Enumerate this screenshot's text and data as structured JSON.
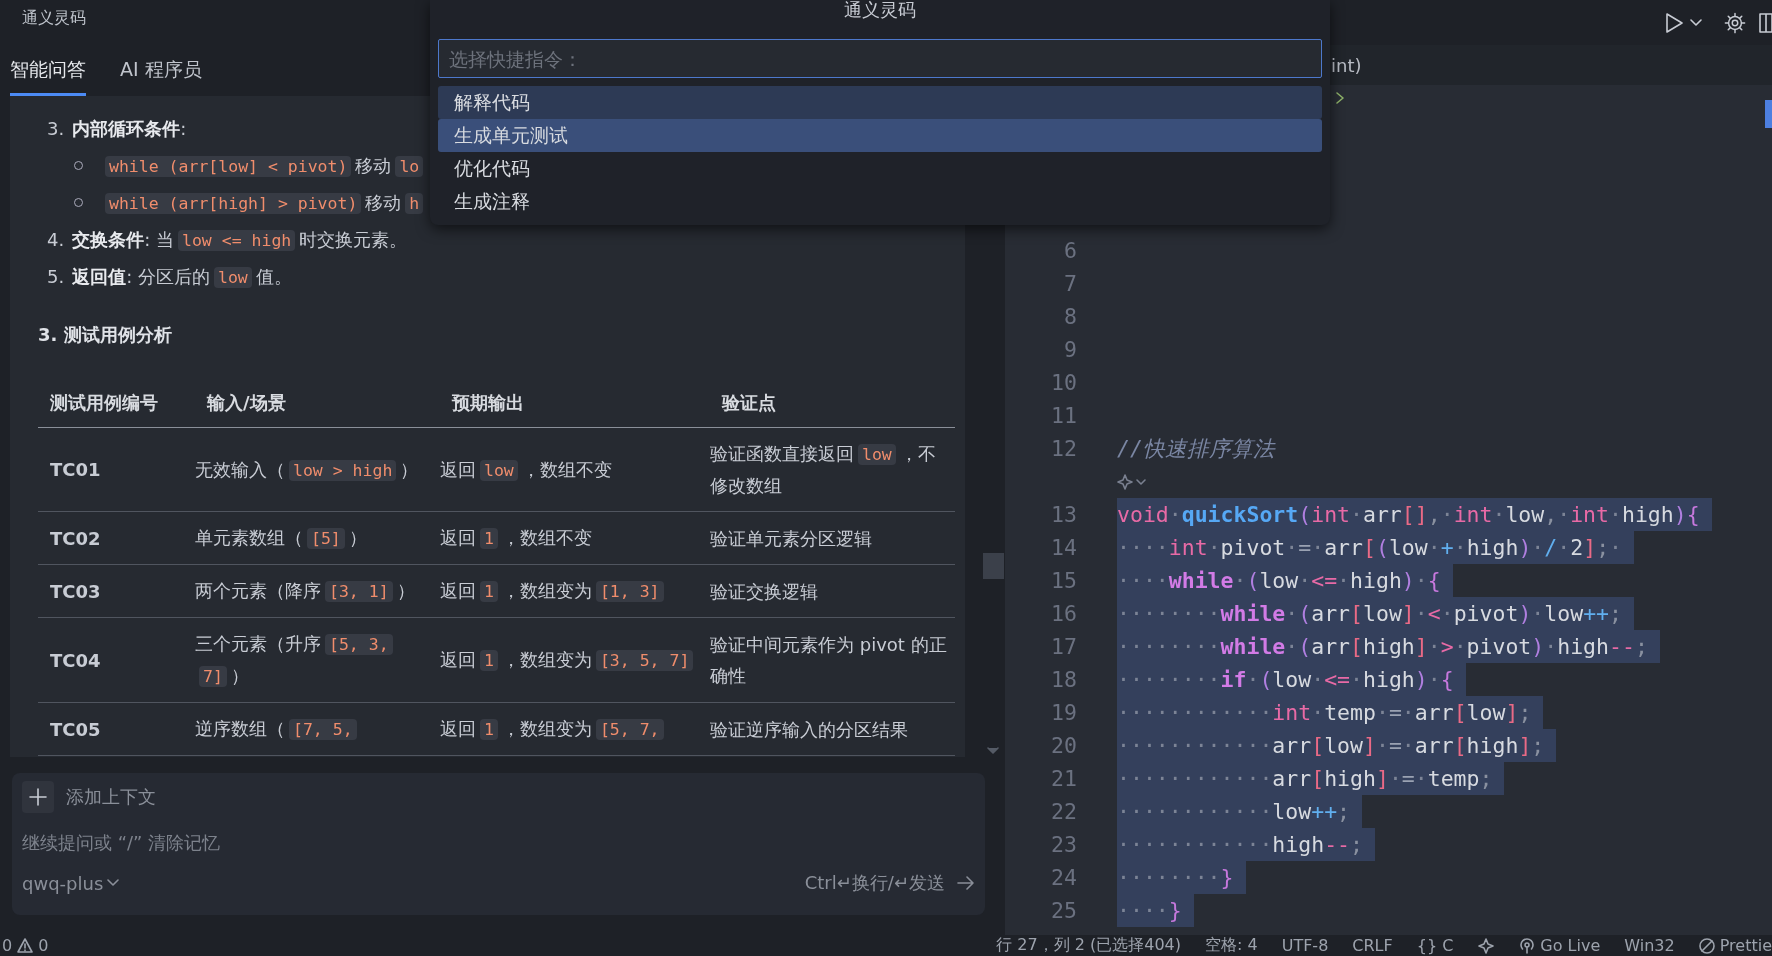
{
  "chat_panel": {
    "title": "通义灵码",
    "tabs": [
      {
        "label": "智能问答",
        "selected": true
      },
      {
        "label": "AI 程序员",
        "selected": false
      }
    ],
    "items": [
      {
        "kind": "numbered",
        "number": "3.",
        "parts": [
          {
            "text": "**内部循环条件**:"
          }
        ]
      },
      {
        "kind": "bullet",
        "parts": [
          {
            "code": "while (arr[low] < pivot)"
          },
          {
            "text": "移动"
          },
          {
            "code": "lo"
          }
        ]
      },
      {
        "kind": "bullet",
        "parts": [
          {
            "code": "while (arr[high] > pivot)"
          },
          {
            "text": "移动"
          },
          {
            "code": "h"
          }
        ]
      },
      {
        "kind": "numbered",
        "number": "4.",
        "parts": [
          {
            "text": "**交换条件**: 当"
          },
          {
            "code": "low <= high"
          },
          {
            "text": "时交换元素。"
          }
        ]
      },
      {
        "kind": "numbered",
        "number": "5.",
        "parts": [
          {
            "text": "**返回值**: 分区后的"
          },
          {
            "code": "low"
          },
          {
            "text": "值。"
          }
        ]
      }
    ],
    "heading": "3. 测试用例分析",
    "table": {
      "columns": [
        "测试用例编号",
        "输入/场景",
        "预期输出",
        "验证点"
      ],
      "rows": [
        [
          [
            {
              "text": "TC01"
            }
          ],
          [
            {
              "text": "无效输入（"
            },
            {
              "code": "low > high"
            },
            {
              "text": "）"
            }
          ],
          [
            {
              "text": "返回"
            },
            {
              "code": "low"
            },
            {
              "text": "，数组不变"
            }
          ],
          [
            {
              "text": "验证函数直接返回"
            },
            {
              "code": "low"
            },
            {
              "text": "，不修改数组"
            }
          ]
        ],
        [
          [
            {
              "text": "TC02"
            }
          ],
          [
            {
              "text": "单元素数组（"
            },
            {
              "code": "[5]"
            },
            {
              "text": "）"
            }
          ],
          [
            {
              "text": "返回"
            },
            {
              "code": "1"
            },
            {
              "text": "，数组不变"
            }
          ],
          [
            {
              "text": "验证单元素分区逻辑"
            }
          ]
        ],
        [
          [
            {
              "text": "TC03"
            }
          ],
          [
            {
              "text": "两个元素（降序"
            },
            {
              "code": "[3, 1]"
            },
            {
              "text": "）"
            }
          ],
          [
            {
              "text": "返回"
            },
            {
              "code": "1"
            },
            {
              "text": "，数组变为"
            },
            {
              "code": "[1, 3]"
            }
          ],
          [
            {
              "text": "验证交换逻辑"
            }
          ]
        ],
        [
          [
            {
              "text": "TC04"
            }
          ],
          [
            {
              "text": "三个元素（升序"
            },
            {
              "code": "[5, 3, 7]"
            },
            {
              "text": "）"
            }
          ],
          [
            {
              "text": "返回"
            },
            {
              "code": "1"
            },
            {
              "text": "，数组变为"
            },
            {
              "code": "[3, 5, 7]"
            }
          ],
          [
            {
              "text": "验证中间元素作为 pivot 的正确性"
            }
          ]
        ],
        [
          [
            {
              "text": "TC05"
            }
          ],
          [
            {
              "text": "逆序数组（"
            },
            {
              "code": "[7, 5,"
            }
          ],
          [
            {
              "text": "返回"
            },
            {
              "code": "1"
            },
            {
              "text": "，数组变为"
            },
            {
              "code": "[5, 7,"
            }
          ],
          [
            {
              "text": "验证逆序输入的分区结果"
            }
          ]
        ]
      ]
    },
    "input": {
      "add_context": "添加上下文",
      "placeholder": "继续提问或 “/” 清除记忆",
      "model": "qwq-plus",
      "hint": "Ctrl↵换行/↵发送"
    }
  },
  "command_palette": {
    "title": "通义灵码",
    "placeholder": "选择快捷指令：",
    "items": [
      {
        "label": "解释代码",
        "selected": false,
        "hovered": true
      },
      {
        "label": "生成单元测试",
        "selected": true,
        "hovered": false
      },
      {
        "label": "优化代码",
        "selected": false,
        "hovered": false
      },
      {
        "label": "生成注释",
        "selected": false,
        "hovered": false
      }
    ]
  },
  "editor": {
    "tab": "int)",
    "lines": [
      {
        "kind": "code",
        "number": "6"
      },
      {
        "kind": "code",
        "number": "7"
      },
      {
        "kind": "code",
        "number": "8"
      },
      {
        "kind": "code",
        "number": "9"
      },
      {
        "kind": "code",
        "number": "10"
      },
      {
        "kind": "code",
        "number": "11"
      },
      {
        "kind": "code",
        "number": "12",
        "selected": false,
        "tokens": [
          {
            "text": "//快速排序算法",
            "kind": "cm"
          }
        ]
      },
      {
        "kind": "lens"
      },
      {
        "kind": "code",
        "number": "13",
        "selected": true,
        "tokens": [
          {
            "text": "void",
            "kind": "kw"
          },
          {
            "text": "·",
            "kind": "ws"
          },
          {
            "text": "quickSort",
            "kind": "fn"
          },
          {
            "text": "(",
            "kind": "pa"
          },
          {
            "text": "int",
            "kind": "kw"
          },
          {
            "text": "·",
            "kind": "ws"
          },
          {
            "text": "arr",
            "kind": "id"
          },
          {
            "text": "[]",
            "kind": "br"
          },
          {
            "text": ",",
            "kind": "p"
          },
          {
            "text": "·",
            "kind": "ws"
          },
          {
            "text": "int",
            "kind": "kw"
          },
          {
            "text": "·",
            "kind": "ws"
          },
          {
            "text": "low",
            "kind": "id"
          },
          {
            "text": ",",
            "kind": "p"
          },
          {
            "text": "·",
            "kind": "ws"
          },
          {
            "text": "int",
            "kind": "kw"
          },
          {
            "text": "·",
            "kind": "ws"
          },
          {
            "text": "high",
            "kind": "id"
          },
          {
            "text": ")",
            "kind": "pa"
          },
          {
            "text": "{",
            "kind": "cb"
          }
        ]
      },
      {
        "kind": "code",
        "number": "14",
        "selected": true,
        "tokens": [
          {
            "text": "····",
            "kind": "ws"
          },
          {
            "text": "int",
            "kind": "kw"
          },
          {
            "text": "·",
            "kind": "ws"
          },
          {
            "text": "pivot",
            "kind": "id"
          },
          {
            "text": "·",
            "kind": "ws"
          },
          {
            "text": "=",
            "kind": "eq"
          },
          {
            "text": "·",
            "kind": "ws"
          },
          {
            "text": "arr",
            "kind": "id"
          },
          {
            "text": "[",
            "kind": "br"
          },
          {
            "text": "(",
            "kind": "pa"
          },
          {
            "text": "low",
            "kind": "id"
          },
          {
            "text": "·",
            "kind": "ws"
          },
          {
            "text": "+",
            "kind": "op2"
          },
          {
            "text": "·",
            "kind": "ws"
          },
          {
            "text": "high",
            "kind": "id"
          },
          {
            "text": ")",
            "kind": "pa"
          },
          {
            "text": "·",
            "kind": "ws"
          },
          {
            "text": "/",
            "kind": "op2"
          },
          {
            "text": "·",
            "kind": "ws"
          },
          {
            "text": "2",
            "kind": "id"
          },
          {
            "text": "]",
            "kind": "br"
          },
          {
            "text": ";",
            "kind": "p"
          },
          {
            "text": "·",
            "kind": "ws"
          }
        ]
      },
      {
        "kind": "code",
        "number": "15",
        "selected": true,
        "tokens": [
          {
            "text": "····",
            "kind": "ws"
          },
          {
            "text": "while",
            "kind": "ctl"
          },
          {
            "text": "·",
            "kind": "ws"
          },
          {
            "text": "(",
            "kind": "pa"
          },
          {
            "text": "low",
            "kind": "id"
          },
          {
            "text": "·",
            "kind": "ws"
          },
          {
            "text": "<=",
            "kind": "op"
          },
          {
            "text": "·",
            "kind": "ws"
          },
          {
            "text": "high",
            "kind": "id"
          },
          {
            "text": ")",
            "kind": "pa"
          },
          {
            "text": "·",
            "kind": "ws"
          },
          {
            "text": "{",
            "kind": "cb"
          }
        ]
      },
      {
        "kind": "code",
        "number": "16",
        "selected": true,
        "tokens": [
          {
            "text": "········",
            "kind": "ws"
          },
          {
            "text": "while",
            "kind": "ctl"
          },
          {
            "text": "·",
            "kind": "ws"
          },
          {
            "text": "(",
            "kind": "pa"
          },
          {
            "text": "arr",
            "kind": "id"
          },
          {
            "text": "[",
            "kind": "br"
          },
          {
            "text": "low",
            "kind": "id"
          },
          {
            "text": "]",
            "kind": "br"
          },
          {
            "text": "·",
            "kind": "ws"
          },
          {
            "text": "<",
            "kind": "op"
          },
          {
            "text": "·",
            "kind": "ws"
          },
          {
            "text": "pivot",
            "kind": "id"
          },
          {
            "text": ")",
            "kind": "pa"
          },
          {
            "text": "·",
            "kind": "ws"
          },
          {
            "text": "low",
            "kind": "id"
          },
          {
            "text": "++",
            "kind": "op2"
          },
          {
            "text": ";",
            "kind": "p"
          }
        ]
      },
      {
        "kind": "code",
        "number": "17",
        "selected": true,
        "tokens": [
          {
            "text": "········",
            "kind": "ws"
          },
          {
            "text": "while",
            "kind": "ctl"
          },
          {
            "text": "·",
            "kind": "ws"
          },
          {
            "text": "(",
            "kind": "pa"
          },
          {
            "text": "arr",
            "kind": "id"
          },
          {
            "text": "[",
            "kind": "br"
          },
          {
            "text": "high",
            "kind": "id"
          },
          {
            "text": "]",
            "kind": "br"
          },
          {
            "text": "·",
            "kind": "ws"
          },
          {
            "text": ">",
            "kind": "op"
          },
          {
            "text": "·",
            "kind": "ws"
          },
          {
            "text": "pivot",
            "kind": "id"
          },
          {
            "text": ")",
            "kind": "pa"
          },
          {
            "text": "·",
            "kind": "ws"
          },
          {
            "text": "high",
            "kind": "id"
          },
          {
            "text": "--",
            "kind": "op"
          },
          {
            "text": ";",
            "kind": "p"
          }
        ]
      },
      {
        "kind": "code",
        "number": "18",
        "selected": true,
        "tokens": [
          {
            "text": "········",
            "kind": "ws"
          },
          {
            "text": "if",
            "kind": "ctl"
          },
          {
            "text": "·",
            "kind": "ws"
          },
          {
            "text": "(",
            "kind": "pa"
          },
          {
            "text": "low",
            "kind": "id"
          },
          {
            "text": "·",
            "kind": "ws"
          },
          {
            "text": "<=",
            "kind": "op"
          },
          {
            "text": "·",
            "kind": "ws"
          },
          {
            "text": "high",
            "kind": "id"
          },
          {
            "text": ")",
            "kind": "pa"
          },
          {
            "text": "·",
            "kind": "ws"
          },
          {
            "text": "{",
            "kind": "cb"
          }
        ]
      },
      {
        "kind": "code",
        "number": "19",
        "selected": true,
        "tokens": [
          {
            "text": "············",
            "kind": "ws"
          },
          {
            "text": "int",
            "kind": "kw"
          },
          {
            "text": "·",
            "kind": "ws"
          },
          {
            "text": "temp",
            "kind": "id"
          },
          {
            "text": "·",
            "kind": "ws"
          },
          {
            "text": "=",
            "kind": "eq"
          },
          {
            "text": "·",
            "kind": "ws"
          },
          {
            "text": "arr",
            "kind": "id"
          },
          {
            "text": "[",
            "kind": "br"
          },
          {
            "text": "low",
            "kind": "id"
          },
          {
            "text": "]",
            "kind": "br"
          },
          {
            "text": ";",
            "kind": "p"
          }
        ]
      },
      {
        "kind": "code",
        "number": "20",
        "selected": true,
        "tokens": [
          {
            "text": "············",
            "kind": "ws"
          },
          {
            "text": "arr",
            "kind": "id"
          },
          {
            "text": "[",
            "kind": "br"
          },
          {
            "text": "low",
            "kind": "id"
          },
          {
            "text": "]",
            "kind": "br"
          },
          {
            "text": "·",
            "kind": "ws"
          },
          {
            "text": "=",
            "kind": "eq"
          },
          {
            "text": "·",
            "kind": "ws"
          },
          {
            "text": "arr",
            "kind": "id"
          },
          {
            "text": "[",
            "kind": "br"
          },
          {
            "text": "high",
            "kind": "id"
          },
          {
            "text": "]",
            "kind": "br"
          },
          {
            "text": ";",
            "kind": "p"
          }
        ]
      },
      {
        "kind": "code",
        "number": "21",
        "selected": true,
        "tokens": [
          {
            "text": "············",
            "kind": "ws"
          },
          {
            "text": "arr",
            "kind": "id"
          },
          {
            "text": "[",
            "kind": "br"
          },
          {
            "text": "high",
            "kind": "id"
          },
          {
            "text": "]",
            "kind": "br"
          },
          {
            "text": "·",
            "kind": "ws"
          },
          {
            "text": "=",
            "kind": "eq"
          },
          {
            "text": "·",
            "kind": "ws"
          },
          {
            "text": "temp",
            "kind": "id"
          },
          {
            "text": ";",
            "kind": "p"
          }
        ]
      },
      {
        "kind": "code",
        "number": "22",
        "selected": true,
        "tokens": [
          {
            "text": "············",
            "kind": "ws"
          },
          {
            "text": "low",
            "kind": "id"
          },
          {
            "text": "++",
            "kind": "op2"
          },
          {
            "text": ";",
            "kind": "p"
          }
        ]
      },
      {
        "kind": "code",
        "number": "23",
        "selected": true,
        "tokens": [
          {
            "text": "············",
            "kind": "ws"
          },
          {
            "text": "high",
            "kind": "id"
          },
          {
            "text": "--",
            "kind": "op"
          },
          {
            "text": ";",
            "kind": "p"
          }
        ]
      },
      {
        "kind": "code",
        "number": "24",
        "selected": true,
        "tokens": [
          {
            "text": "········",
            "kind": "ws"
          },
          {
            "text": "}",
            "kind": "cb"
          }
        ]
      },
      {
        "kind": "code",
        "number": "25",
        "selected": true,
        "tokens": [
          {
            "text": "····",
            "kind": "ws"
          },
          {
            "text": "}",
            "kind": "cb"
          }
        ]
      }
    ]
  },
  "status_bar": {
    "errors": "0",
    "warnings": "0",
    "position": "行 27，列 2 (已选择404)",
    "indent": "空格: 4",
    "encoding": "UTF-8",
    "eol": "CRLF",
    "language": "{} C",
    "live": "Go Live",
    "platform": "Win32",
    "formatter": "Prettie"
  }
}
